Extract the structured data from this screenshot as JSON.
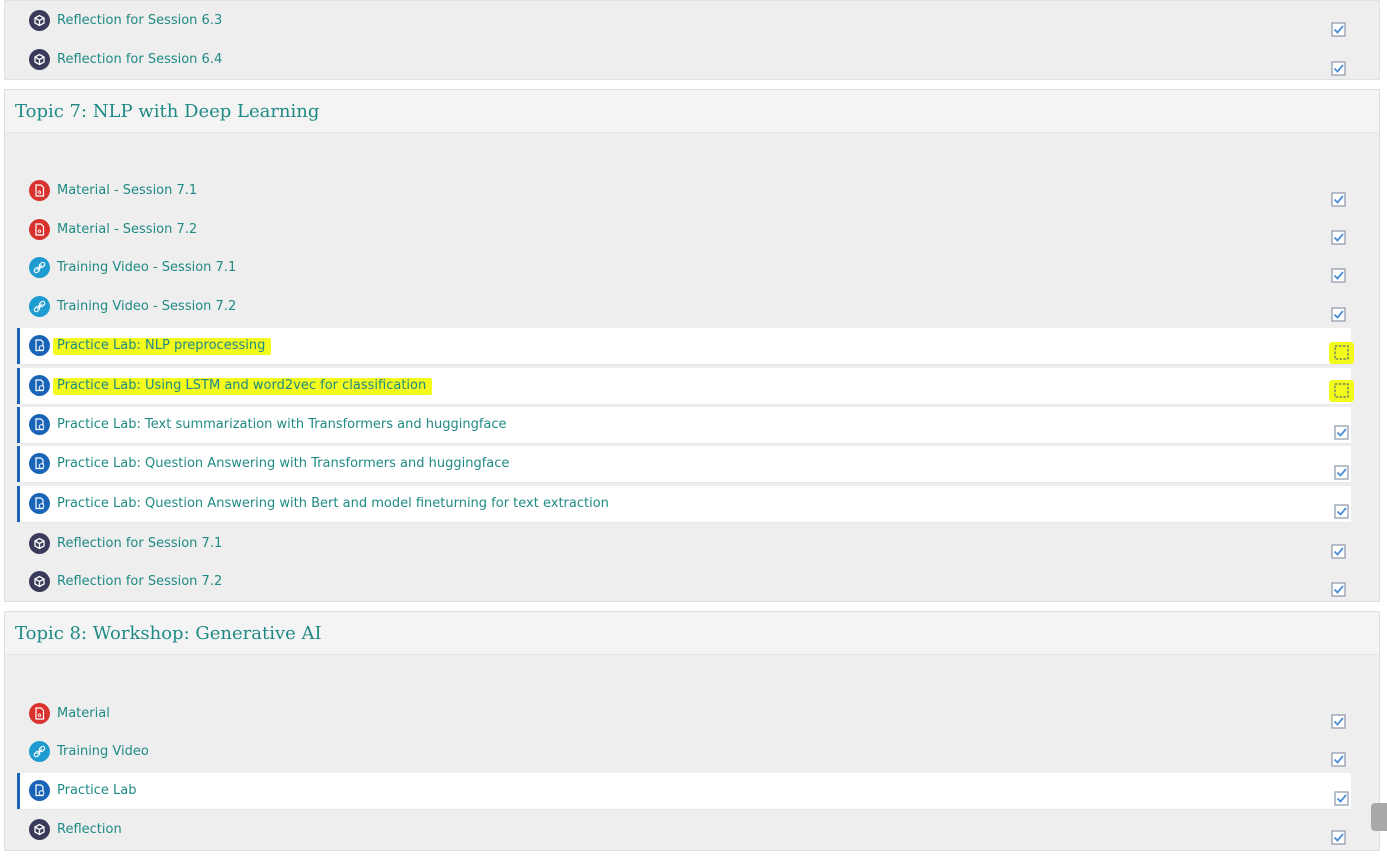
{
  "section6": {
    "items": [
      {
        "label": "Reflection for Session 6.3",
        "type": "reflection",
        "done": true
      },
      {
        "label": "Reflection for Session 6.4",
        "type": "reflection",
        "done": true
      }
    ]
  },
  "topic7": {
    "title": "Topic 7: NLP with Deep Learning",
    "items": [
      {
        "label": "Material - Session 7.1",
        "type": "pdf",
        "done": true
      },
      {
        "label": "Material - Session 7.2",
        "type": "pdf",
        "done": true
      },
      {
        "label": "Training Video - Session 7.1",
        "type": "link",
        "done": true
      },
      {
        "label": "Training Video - Session 7.2",
        "type": "link",
        "done": true
      },
      {
        "label": "Practice Lab: NLP preprocessing",
        "type": "lab",
        "done": false,
        "highlighted": true
      },
      {
        "label": "Practice Lab: Using LSTM and word2vec for classification",
        "type": "lab",
        "done": false,
        "highlighted": true
      },
      {
        "label": "Practice Lab: Text summarization with Transformers and huggingface",
        "type": "lab",
        "done": true
      },
      {
        "label": "Practice Lab: Question Answering with Transformers and huggingface",
        "type": "lab",
        "done": true
      },
      {
        "label": "Practice Lab: Question Answering with Bert and model fineturning for text extraction",
        "type": "lab",
        "done": true
      },
      {
        "label": "Reflection for Session 7.1",
        "type": "reflection",
        "done": true
      },
      {
        "label": "Reflection for Session 7.2",
        "type": "reflection",
        "done": true
      }
    ]
  },
  "topic8": {
    "title": "Topic 8: Workshop: Generative AI",
    "items": [
      {
        "label": "Material",
        "type": "pdf",
        "done": true
      },
      {
        "label": "Training Video",
        "type": "link",
        "done": true
      },
      {
        "label": "Practice Lab",
        "type": "lab",
        "done": true
      },
      {
        "label": "Reflection",
        "type": "reflection",
        "done": true
      }
    ]
  },
  "colors": {
    "link_text": "#1f8a85",
    "highlight": "#f3fb1c",
    "lab_accent": "#1a64b8",
    "pdf_icon": "#d8322e",
    "video_icon": "#1e9bd0",
    "reflection_icon": "#3a3a5a"
  },
  "icons": {
    "pdf": "pdf-icon",
    "link": "link-icon",
    "lab": "lab-icon",
    "reflection": "reflection-icon",
    "done": "checkbox-checked-icon",
    "empty": "checkbox-empty-icon"
  }
}
